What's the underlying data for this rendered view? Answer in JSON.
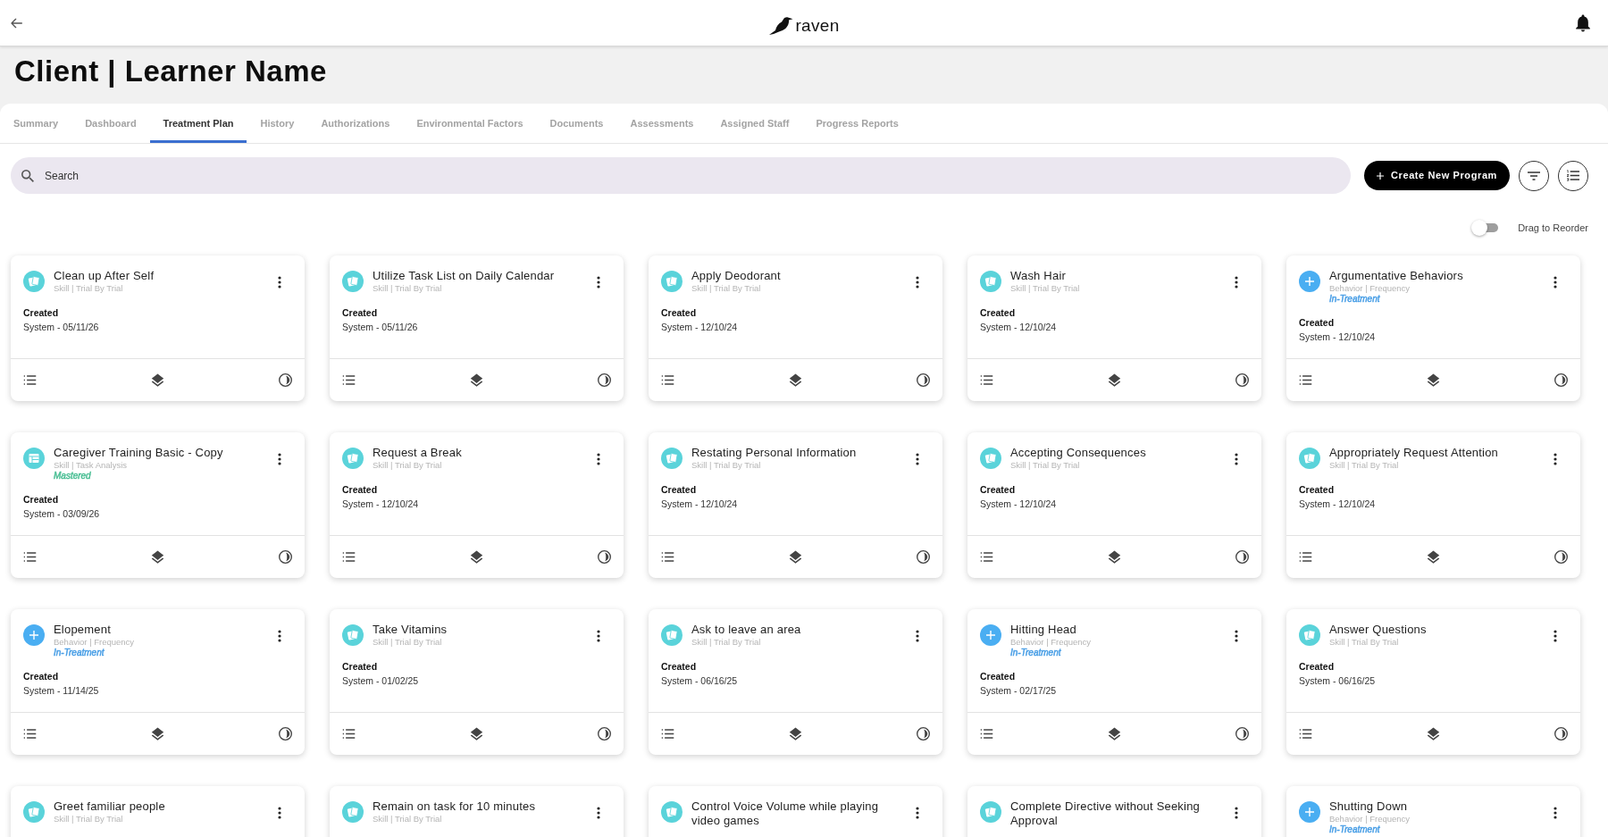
{
  "header": {
    "logo_text": "raven"
  },
  "page_title": "Client | Learner Name",
  "tabs": [
    {
      "label": "Summary",
      "selected": false
    },
    {
      "label": "Dashboard",
      "selected": false
    },
    {
      "label": "Treatment Plan",
      "selected": true
    },
    {
      "label": "History",
      "selected": false
    },
    {
      "label": "Authorizations",
      "selected": false
    },
    {
      "label": "Environmental Factors",
      "selected": false
    },
    {
      "label": "Documents",
      "selected": false
    },
    {
      "label": "Assessments",
      "selected": false
    },
    {
      "label": "Assigned Staff",
      "selected": false
    },
    {
      "label": "Progress Reports",
      "selected": false
    }
  ],
  "search": {
    "placeholder": "Search"
  },
  "toolbar": {
    "create_button": "Create New Program"
  },
  "reorder_toggle": {
    "label": "Drag to Reorder",
    "on": false
  },
  "cards": [
    {
      "kind": "skill",
      "title": "Clean up After Self",
      "subtitle": "Skill | Trial By Trial",
      "created_label": "Created",
      "created_info": "System - 05/11/26"
    },
    {
      "kind": "skill",
      "title": "Utilize Task List on Daily Calendar",
      "subtitle": "Skill | Trial By Trial",
      "created_label": "Created",
      "created_info": "System - 05/11/26"
    },
    {
      "kind": "skill",
      "title": "Apply Deodorant",
      "subtitle": "Skill | Trial By Trial",
      "created_label": "Created",
      "created_info": "System - 12/10/24"
    },
    {
      "kind": "skill",
      "title": "Wash Hair",
      "subtitle": "Skill | Trial By Trial",
      "created_label": "Created",
      "created_info": "System - 12/10/24"
    },
    {
      "kind": "behavior",
      "title": "Argumentative Behaviors",
      "subtitle": "Behavior | Frequency",
      "status": {
        "label": "In-Treatment",
        "color": "#4a9fe6"
      },
      "created_label": "Created",
      "created_info": "System - 12/10/24"
    },
    {
      "kind": "analysis",
      "title": "Caregiver Training Basic - Copy",
      "subtitle": "Skill | Task Analysis",
      "status": {
        "label": "Mastered",
        "color": "#4cbf95"
      },
      "created_label": "Created",
      "created_info": "System - 03/09/26"
    },
    {
      "kind": "skill",
      "title": "Request a Break",
      "subtitle": "Skill | Trial By Trial",
      "created_label": "Created",
      "created_info": "System - 12/10/24"
    },
    {
      "kind": "skill",
      "title": "Restating Personal Information",
      "subtitle": "Skill | Trial By Trial",
      "created_label": "Created",
      "created_info": "System - 12/10/24"
    },
    {
      "kind": "skill",
      "title": "Accepting Consequences",
      "subtitle": "Skill | Trial By Trial",
      "created_label": "Created",
      "created_info": "System - 12/10/24"
    },
    {
      "kind": "skill",
      "title": "Appropriately Request Attention",
      "subtitle": "Skill | Trial By Trial",
      "created_label": "Created",
      "created_info": "System - 12/10/24"
    },
    {
      "kind": "behavior",
      "title": "Elopement",
      "subtitle": "Behavior | Frequency",
      "status": {
        "label": "In-Treatment",
        "color": "#4a9fe6"
      },
      "created_label": "Created",
      "created_info": "System - 11/14/25"
    },
    {
      "kind": "skill",
      "title": "Take Vitamins",
      "subtitle": "Skill | Trial By Trial",
      "created_label": "Created",
      "created_info": "System - 01/02/25"
    },
    {
      "kind": "skill",
      "title": "Ask to leave an area",
      "subtitle": "Skill | Trial By Trial",
      "created_label": "Created",
      "created_info": "System - 06/16/25"
    },
    {
      "kind": "behavior",
      "title": "Hitting Head",
      "subtitle": "Behavior | Frequency",
      "status": {
        "label": "In-Treatment",
        "color": "#4a9fe6"
      },
      "created_label": "Created",
      "created_info": "System - 02/17/25"
    },
    {
      "kind": "skill",
      "title": "Answer Questions",
      "subtitle": "Skill | Trial By Trial",
      "created_label": "Created",
      "created_info": "System - 06/16/25"
    },
    {
      "kind": "skill",
      "title": "Greet familiar people",
      "subtitle": "Skill | Trial By Trial"
    },
    {
      "kind": "skill",
      "title": "Remain on task for 10 minutes",
      "subtitle": "Skill | Trial By Trial"
    },
    {
      "kind": "skill",
      "title": "Control Voice Volume while playing video games"
    },
    {
      "kind": "skill",
      "title": "Complete Directive without Seeking Approval"
    },
    {
      "kind": "behavior",
      "title": "Shutting Down",
      "subtitle": "Behavior | Frequency",
      "status": {
        "label": "In-Treatment",
        "color": "#4a9fe6"
      }
    }
  ]
}
